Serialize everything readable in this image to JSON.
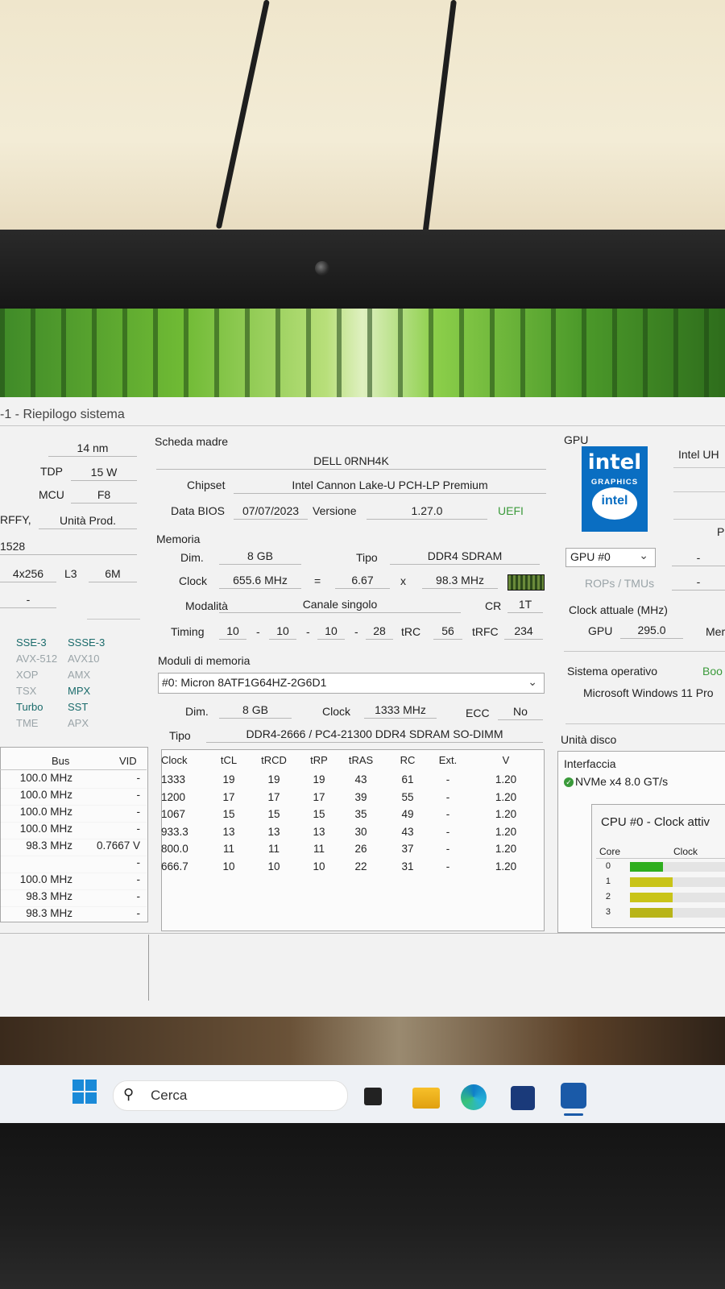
{
  "window_title": "-1 - Riepilogo sistema",
  "cpu_partial": {
    "process": "14 nm",
    "tdp_label": "TDP",
    "tdp_value": "15 W",
    "mcu_label": "MCU",
    "mcu_value": "F8",
    "stepping_fragment": "RFFY,",
    "unit_label": "Unità Prod.",
    "code": "1528",
    "cache_l2": "4x256",
    "l3_label": "L3",
    "l3_value": "6M",
    "dash": "-",
    "features": [
      {
        "name": "SSE-3",
        "on": true
      },
      {
        "name": "SSSE-3",
        "on": true
      },
      {
        "name": "AVX-512",
        "on": false
      },
      {
        "name": "AVX10",
        "on": false
      },
      {
        "name": "XOP",
        "on": false
      },
      {
        "name": "AMX",
        "on": false
      },
      {
        "name": "TSX",
        "on": false
      },
      {
        "name": "MPX",
        "on": true
      },
      {
        "name": "Turbo",
        "on": true
      },
      {
        "name": "SST",
        "on": true
      },
      {
        "name": "TME",
        "on": false
      },
      {
        "name": "APX",
        "on": false
      }
    ],
    "bus_header": "Bus",
    "vid_header": "VID",
    "bus_rows": [
      {
        "bus": "100.0 MHz",
        "vid": "-"
      },
      {
        "bus": "100.0 MHz",
        "vid": "-"
      },
      {
        "bus": "100.0 MHz",
        "vid": "-"
      },
      {
        "bus": "100.0 MHz",
        "vid": "-"
      },
      {
        "bus": "98.3 MHz",
        "vid": "0.7667 V"
      },
      {
        "bus": "",
        "vid": "-"
      },
      {
        "bus": "100.0 MHz",
        "vid": "-"
      },
      {
        "bus": "98.3 MHz",
        "vid": "-"
      },
      {
        "bus": "98.3 MHz",
        "vid": "-"
      }
    ]
  },
  "motherboard": {
    "section": "Scheda madre",
    "name": "DELL 0RNH4K",
    "chipset_label": "Chipset",
    "chipset": "Intel Cannon Lake-U PCH-LP Premium",
    "bios_label": "Data BIOS",
    "bios_date": "07/07/2023",
    "version_label": "Versione",
    "version": "1.27.0",
    "uefi": "UEFI"
  },
  "memory": {
    "section": "Memoria",
    "size_label": "Dim.",
    "size": "8 GB",
    "type_label": "Tipo",
    "type": "DDR4 SDRAM",
    "clock_label": "Clock",
    "clock": "655.6 MHz",
    "eq": "=",
    "mult": "6.67",
    "x": "x",
    "base": "98.3 MHz",
    "mode_label": "Modalità",
    "mode": "Canale singolo",
    "cr_label": "CR",
    "cr": "1T",
    "timing_label": "Timing",
    "t1": "10",
    "t2": "10",
    "t3": "10",
    "t4": "28",
    "dash": "-",
    "trc_label": "tRC",
    "trc": "56",
    "trfc_label": "tRFC",
    "trfc": "234"
  },
  "modules": {
    "section": "Moduli di memoria",
    "selected": "#0: Micron 8ATF1G64HZ-2G6D1",
    "size_label": "Dim.",
    "size": "8 GB",
    "clock_label": "Clock",
    "clock": "1333 MHz",
    "ecc_label": "ECC",
    "ecc": "No",
    "type_label": "Tipo",
    "type": "DDR4-2666 / PC4-21300 DDR4 SDRAM SO-DIMM",
    "headers": [
      "Clock",
      "tCL",
      "tRCD",
      "tRP",
      "tRAS",
      "RC",
      "Ext.",
      "V"
    ],
    "rows": [
      [
        "1333",
        "19",
        "19",
        "19",
        "43",
        "61",
        "-",
        "1.20"
      ],
      [
        "1200",
        "17",
        "17",
        "17",
        "39",
        "55",
        "-",
        "1.20"
      ],
      [
        "1067",
        "15",
        "15",
        "15",
        "35",
        "49",
        "-",
        "1.20"
      ],
      [
        "933.3",
        "13",
        "13",
        "13",
        "30",
        "43",
        "-",
        "1.20"
      ],
      [
        "800.0",
        "11",
        "11",
        "11",
        "26",
        "37",
        "-",
        "1.20"
      ],
      [
        "666.7",
        "10",
        "10",
        "10",
        "22",
        "31",
        "-",
        "1.20"
      ]
    ]
  },
  "gpu": {
    "section": "GPU",
    "logo_text": "intel",
    "logo_sub": "GRAPHICS",
    "logo_ring": "intel",
    "name_partial": "Intel UH",
    "selector": "GPU #0",
    "rops": "ROPs / TMUs",
    "dash": "-",
    "p_fragment": "P",
    "clock_title": "Clock attuale (MHz)",
    "gpu_label": "GPU",
    "gpu_clock": "295.0",
    "mem_fragment": "Mer"
  },
  "os": {
    "section": "Sistema operativo",
    "boot_fragment": "Boo",
    "name": "Microsoft Windows 11 Pro"
  },
  "disk": {
    "section": "Unità disco",
    "interface_label": "Interfaccia",
    "interface": "NVMe x4 8.0 GT/s"
  },
  "cpu_clock": {
    "title": "CPU #0 - Clock attiv",
    "core_header": "Core",
    "clock_header": "Clock",
    "cores": [
      {
        "id": "0",
        "level": 0.35,
        "color": "#2fae1e"
      },
      {
        "id": "1",
        "level": 0.45,
        "color": "#c9c418"
      },
      {
        "id": "2",
        "level": 0.45,
        "color": "#c9c418"
      },
      {
        "id": "3",
        "level": 0.45,
        "color": "#b8b418"
      }
    ]
  },
  "taskbar": {
    "search_placeholder": "Cerca"
  }
}
